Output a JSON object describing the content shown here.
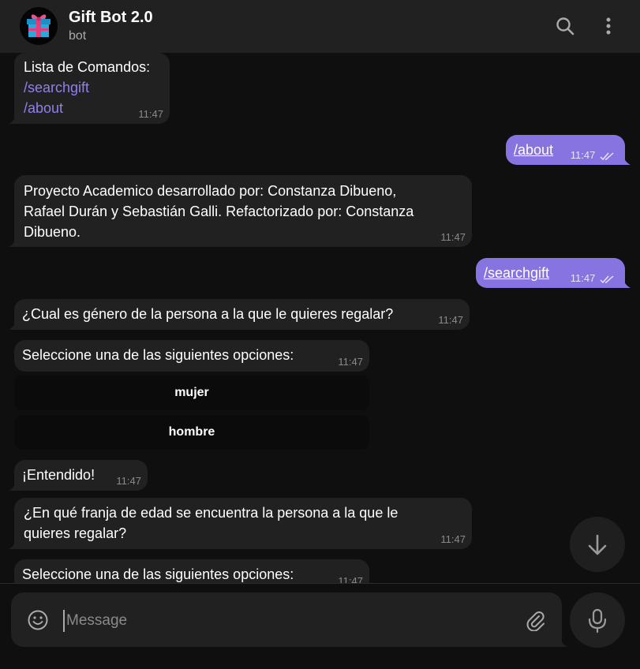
{
  "header": {
    "title": "Gift Bot 2.0",
    "subtitle": "bot",
    "avatar_icon": "gift-icon",
    "search_icon": "search-icon",
    "menu_icon": "more-vertical-icon"
  },
  "messages": [
    {
      "dir": "in",
      "lines": [
        "Lista de Comandos:"
      ],
      "commands": [
        "/searchgift",
        "/about"
      ],
      "time": "11:47"
    },
    {
      "dir": "out",
      "text": "/about",
      "time": "11:47"
    },
    {
      "dir": "in",
      "lines": [
        "Proyecto Academico desarrollado por: Constanza Dibueno,",
        "Rafael Durán y Sebastián Galli. Refactorizado por: Constanza",
        "Dibueno."
      ],
      "time": "11:47"
    },
    {
      "dir": "out",
      "text": "/searchgift",
      "time": "11:47"
    },
    {
      "dir": "in",
      "lines": [
        "¿Cual es género de la persona a la que le quieres regalar?"
      ],
      "time": "11:47"
    },
    {
      "dir": "in",
      "lines": [
        "Seleccione una de las siguientes opciones:"
      ],
      "time": "11:47"
    },
    {
      "dir": "in",
      "lines": [
        "¡Entendido!"
      ],
      "time": "11:47"
    },
    {
      "dir": "in",
      "lines": [
        "¿En qué franja de edad se encuentra la persona a la que le",
        "quieres regalar?"
      ],
      "time": "11:47"
    },
    {
      "dir": "in",
      "lines": [
        "Seleccione una de las siguientes opciones:"
      ],
      "time": "11:47"
    }
  ],
  "keyboard": [
    "mujer",
    "hombre"
  ],
  "composer": {
    "placeholder": "Message",
    "emoji_icon": "emoji-icon",
    "attach_icon": "paperclip-icon",
    "mic_icon": "microphone-icon"
  },
  "colors": {
    "background": "#0f0f0f",
    "header": "#212121",
    "bubble_in": "#212121",
    "bubble_out": "#8774e1",
    "command_link": "#8f80ee",
    "timestamp": "#8a8a8a"
  }
}
